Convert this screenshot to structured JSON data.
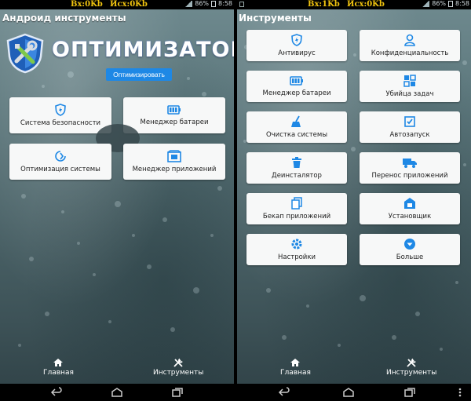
{
  "status": {
    "left": {
      "rx": "Вх:0Kb",
      "tx": "Исх:0Kb",
      "battery": "86%",
      "time": "8:58"
    },
    "right": {
      "rx": "Вх:1Kb",
      "tx": "Исх:0Kb",
      "battery": "86%",
      "time": "8:58"
    }
  },
  "home": {
    "app_title": "Андроид инструменты",
    "brand": "ОПТИМИЗАТОР",
    "optimize_button": "Оптимизировать",
    "cards": [
      {
        "label": "Система безопасности",
        "icon": "shield-icon"
      },
      {
        "label": "Менеджер батареи",
        "icon": "battery-icon"
      },
      {
        "label": "Оптимизация системы",
        "icon": "optimize-icon"
      },
      {
        "label": "Менеджер приложений",
        "icon": "app-manager-icon"
      }
    ]
  },
  "tools": {
    "title": "Инструменты",
    "items": [
      {
        "label": "Антивирус",
        "icon": "shield-icon"
      },
      {
        "label": "Конфиденциальность",
        "icon": "privacy-icon"
      },
      {
        "label": "Менеджер батареи",
        "icon": "battery-icon"
      },
      {
        "label": "Убийца задач",
        "icon": "task-killer-icon"
      },
      {
        "label": "Очистка системы",
        "icon": "broom-icon"
      },
      {
        "label": "Автозапуск",
        "icon": "autostart-icon"
      },
      {
        "label": "Деинсталятор",
        "icon": "trash-icon"
      },
      {
        "label": "Перенос приложений",
        "icon": "truck-icon"
      },
      {
        "label": "Бекап приложений",
        "icon": "backup-icon"
      },
      {
        "label": "Установщик",
        "icon": "installer-icon"
      },
      {
        "label": "Настройки",
        "icon": "gear-icon"
      },
      {
        "label": "Больше",
        "icon": "more-icon"
      }
    ]
  },
  "tabs": {
    "home": "Главная",
    "tools": "Инструменты"
  },
  "colors": {
    "accent": "#1e88e5",
    "card_bg": "#f7f8f8",
    "status_text": "#f1c40f"
  }
}
